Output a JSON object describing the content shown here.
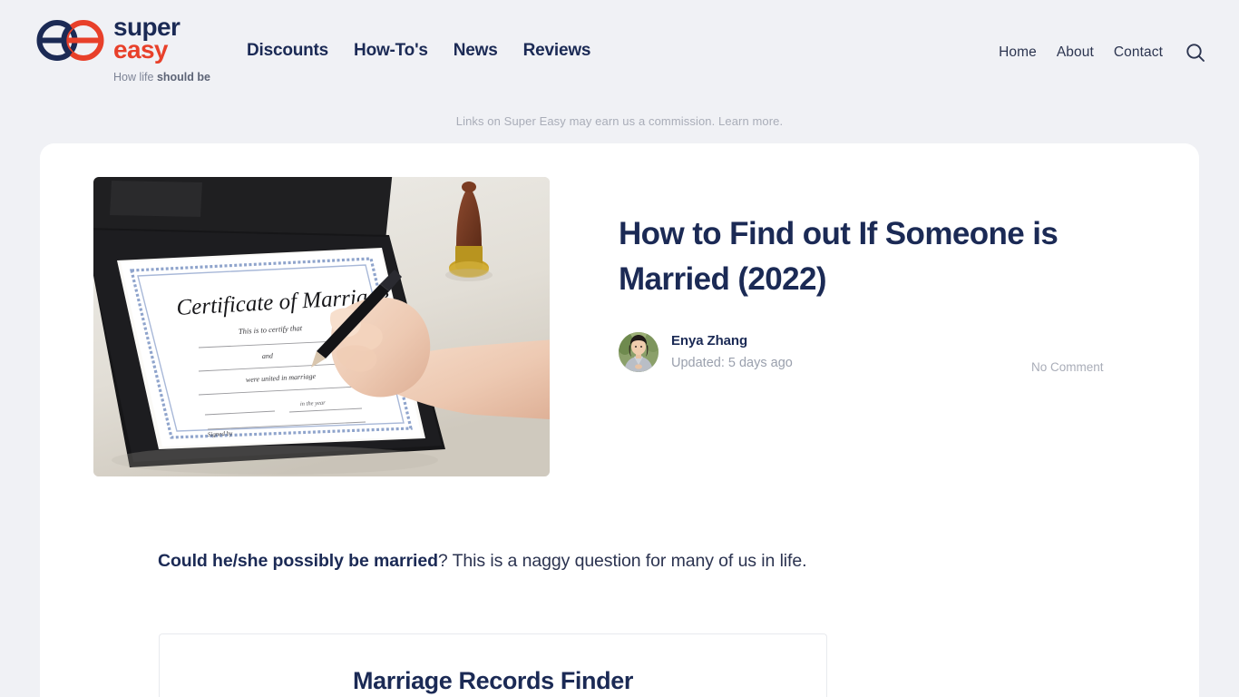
{
  "brand": {
    "logo_icon": "super-easy-double-e-logo",
    "word_super": "super",
    "word_easy": "easy",
    "tagline_prefix": "How life ",
    "tagline_bold": "should be",
    "navy": "#1b2a55",
    "red": "#e8402a"
  },
  "nav": {
    "main": [
      {
        "label": "Discounts"
      },
      {
        "label": "How-To's"
      },
      {
        "label": "News"
      },
      {
        "label": "Reviews"
      }
    ],
    "utility": [
      {
        "label": "Home"
      },
      {
        "label": "About"
      },
      {
        "label": "Contact"
      }
    ],
    "search_icon": "search-icon"
  },
  "disclosure": {
    "text": "Links on Super Easy may earn us a commission. ",
    "link_label": "Learn more."
  },
  "article": {
    "title": "How to Find out If Someone is Married (2022)",
    "hero_image_alt": "Hand signing a Certificate of Marriage in a black folder with a wax seal stamp",
    "author_name": "Enya Zhang",
    "updated": "Updated: 5 days ago",
    "comment_count": "No Comment",
    "lead_bold": "Could he/she possibly be married",
    "lead_rest": "? This is a naggy question for many of us in life."
  },
  "finder": {
    "title": "Marriage Records Finder"
  },
  "colors": {
    "page_background": "#f0f1f5",
    "card_background": "#ffffff",
    "heading": "#1b2a55",
    "muted": "#a9adb8",
    "body_text": "#2b3350",
    "card_border": "#e8eaee"
  }
}
